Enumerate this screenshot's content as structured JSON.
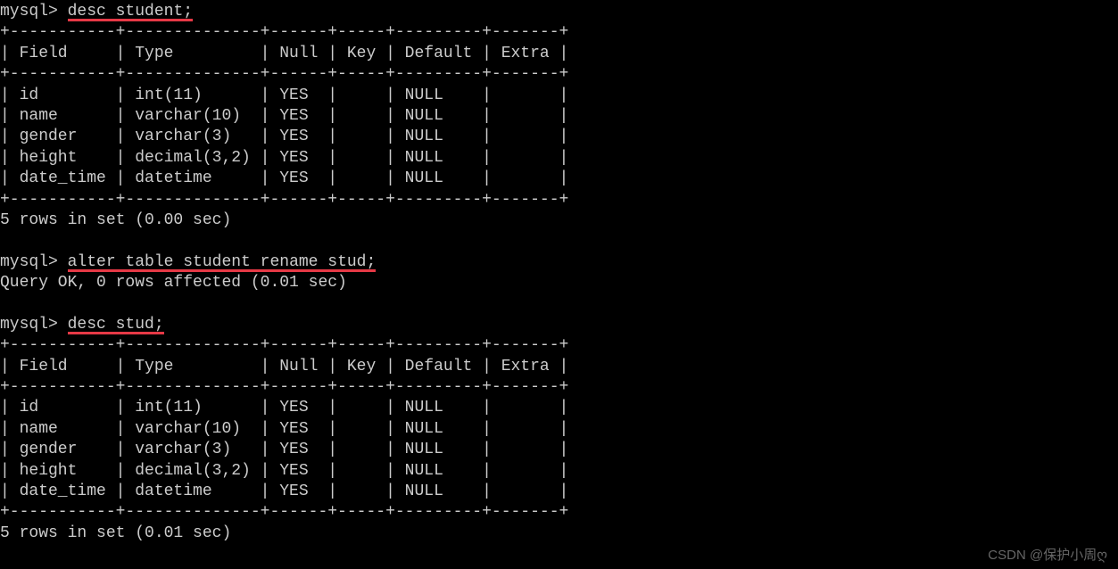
{
  "prompt": "mysql> ",
  "cmd1": "desc student;",
  "cmd2": "alter table student rename stud;",
  "cmd3": "desc stud;",
  "queryOk": "Query OK, 0 rows affected (0.01 sec)",
  "rowsInSet1": "5 rows in set (0.00 sec)",
  "rowsInSet2": "5 rows in set (0.01 sec)",
  "border": "+-----------+--------------+------+-----+---------+-------+",
  "headerRow": "| Field     | Type         | Null | Key | Default | Extra |",
  "dataRows": [
    "| id        | int(11)      | YES  |     | NULL    |       |",
    "| name      | varchar(10)  | YES  |     | NULL    |       |",
    "| gender    | varchar(3)   | YES  |     | NULL    |       |",
    "| height    | decimal(3,2) | YES  |     | NULL    |       |",
    "| date_time | datetime     | YES  |     | NULL    |       |"
  ],
  "watermark": "CSDN @保护小周ღ"
}
